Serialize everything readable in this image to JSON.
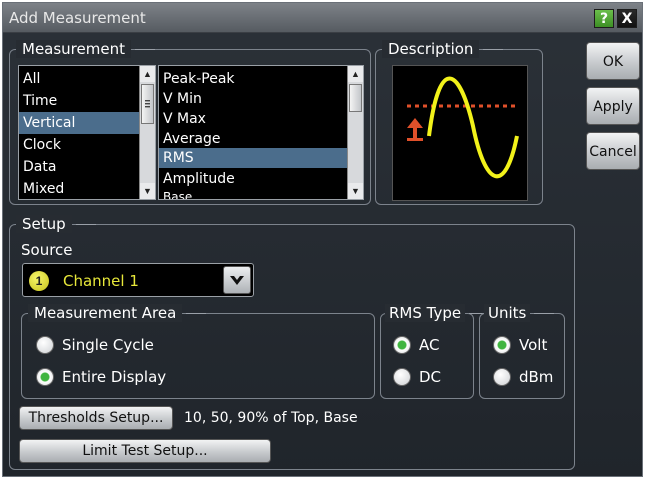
{
  "window": {
    "title": "Add Measurement",
    "help_icon": "?",
    "close_icon": "X"
  },
  "measurement": {
    "legend": "Measurement",
    "categories": [
      "All",
      "Time",
      "Vertical",
      "Clock",
      "Data",
      "Mixed"
    ],
    "selected_category": "Vertical",
    "measurements": [
      "Peak-Peak",
      "V Min",
      "V Max",
      "Average",
      "RMS",
      "Amplitude",
      "Base"
    ],
    "selected_measurement": "RMS"
  },
  "description": {
    "legend": "Description",
    "waveform_color": "#f2f21a",
    "marker_color": "#e0502a"
  },
  "buttons": {
    "ok": "OK",
    "apply": "Apply",
    "cancel": "Cancel",
    "thresholds": "Thresholds Setup...",
    "limit_test": "Limit Test Setup..."
  },
  "setup": {
    "legend": "Setup",
    "source_label": "Source",
    "source_badge": "1",
    "source_value": "Channel 1",
    "source_color": "#e8e83a",
    "thresholds_info": "10, 50, 90% of Top, Base"
  },
  "measurement_area": {
    "legend": "Measurement Area",
    "options": [
      "Single Cycle",
      "Entire Display"
    ],
    "selected": "Entire Display"
  },
  "rms_type": {
    "legend": "RMS Type",
    "options": [
      "AC",
      "DC"
    ],
    "selected": "AC"
  },
  "units": {
    "legend": "Units",
    "options": [
      "Volt",
      "dBm"
    ],
    "selected": "Volt"
  }
}
